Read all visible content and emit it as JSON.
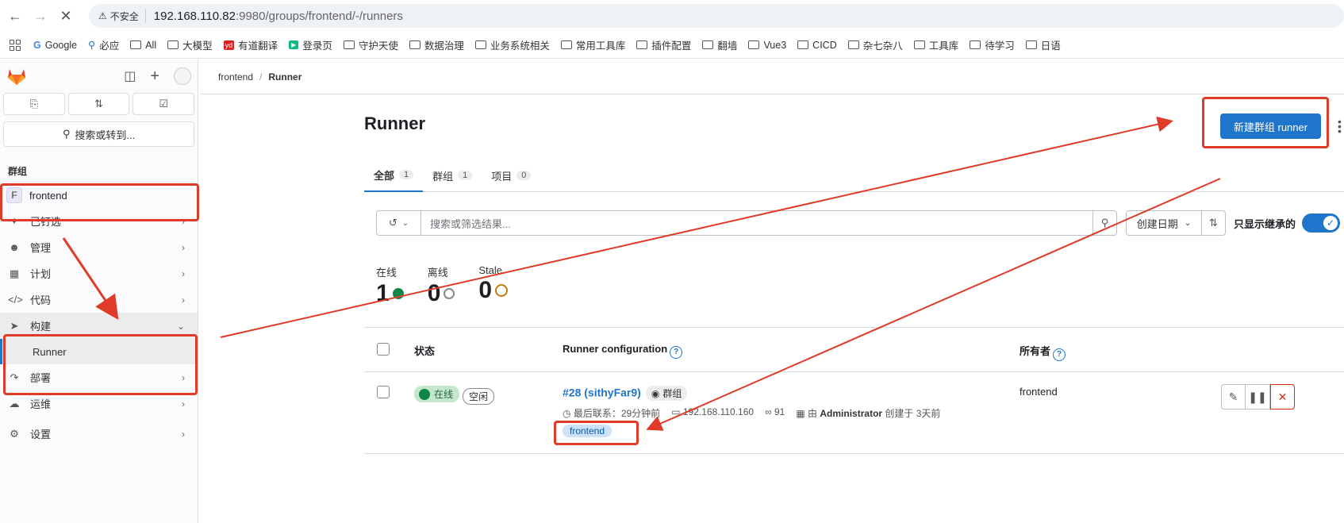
{
  "browser": {
    "insecure_label": "不安全",
    "url_host": "192.168.110.82",
    "url_path": ":9980/groups/frontend/-/runners"
  },
  "bookmarks": [
    "Google",
    "必应",
    "All",
    "大模型",
    "有道翻译",
    "登录页",
    "守护天使",
    "数据治理",
    "业务系统相关",
    "常用工具库",
    "插件配置",
    "翻墙",
    "Vue3",
    "CICD",
    "杂七杂八",
    "工具库",
    "待学习",
    "日语"
  ],
  "sidebar": {
    "search_label": "搜索或转到...",
    "section_label": "群组",
    "group_avatar": "F",
    "group_name": "frontend",
    "items": [
      {
        "label": "已钉选"
      },
      {
        "label": "管理"
      },
      {
        "label": "计划"
      },
      {
        "label": "代码"
      },
      {
        "label": "构建"
      },
      {
        "label": "部署"
      },
      {
        "label": "运维"
      },
      {
        "label": "设置"
      }
    ],
    "sub_item": "Runner"
  },
  "breadcrumb": {
    "parent": "frontend",
    "sep": "/",
    "current": "Runner"
  },
  "page": {
    "title": "Runner",
    "new_button": "新建群组 runner"
  },
  "tabs": [
    {
      "label": "全部",
      "count": "1"
    },
    {
      "label": "群组",
      "count": "1"
    },
    {
      "label": "项目",
      "count": "0"
    }
  ],
  "filter": {
    "placeholder": "搜索或筛选结果...",
    "sort_label": "创建日期",
    "inherited_label": "只显示继承的"
  },
  "stats": {
    "online_label": "在线",
    "online_value": "1",
    "offline_label": "离线",
    "offline_value": "0",
    "stale_label": "Stale",
    "stale_value": "0"
  },
  "table": {
    "col_status": "状态",
    "col_config": "Runner configuration",
    "col_owner": "所有者",
    "rows": [
      {
        "status": "在线",
        "idle": "空闲",
        "name": "#28 (sithyFar9)",
        "scope": "群组",
        "last_contact": "最后联系：29分钟前",
        "ip": "192.168.110.160",
        "jobs": "91",
        "creator_prefix": "由",
        "creator": "Administrator",
        "created": "创建于 3天前",
        "tag": "frontend",
        "owner": "frontend"
      }
    ]
  },
  "colors": {
    "accent": "#1f75cb",
    "annotation": "#e03a28",
    "online": "#108548",
    "danger": "#dd2b0e"
  }
}
